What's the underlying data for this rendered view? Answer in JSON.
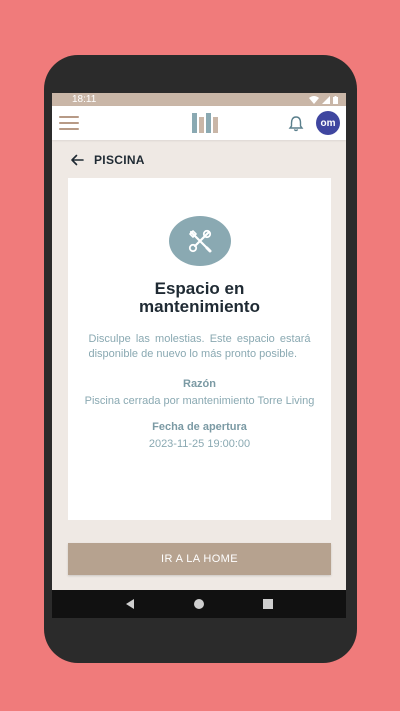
{
  "status_bar": {
    "time": "18:11"
  },
  "app_bar": {
    "avatar_initials": "om",
    "logo_colors": [
      "#8aa9b2",
      "#c9b6a7",
      "#8aa9b2",
      "#c9b6a7"
    ]
  },
  "page": {
    "title": "PISCINA"
  },
  "card": {
    "title": "Espacio en mantenimiento",
    "message": "Disculpe las molestias. Este espacio estará disponible de nuevo lo más pronto posible.",
    "reason_label": "Razón",
    "reason_value": "Piscina cerrada por mantenimiento Torre Living",
    "opening_label": "Fecha de apertura",
    "opening_value": "2023-11-25 19:00:00"
  },
  "actions": {
    "home_button": "IR A LA HOME"
  },
  "colors": {
    "background": "#f07b7b",
    "accent": "#8aa9b2",
    "button": "#b6a28f",
    "avatar": "#3f46a0",
    "status_bar": "#c9b6a7"
  }
}
